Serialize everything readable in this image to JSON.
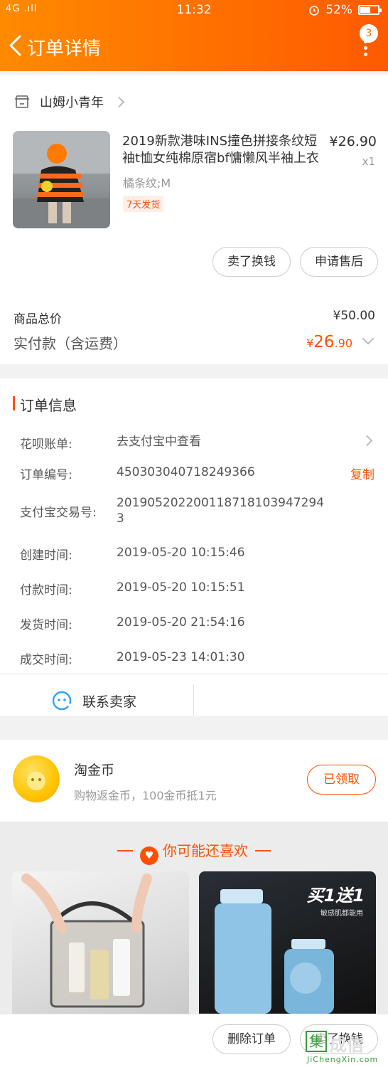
{
  "status_bar": {
    "carrier": "4G .ıll",
    "time": "11:32",
    "battery": "52%",
    "battery_level": 0.52
  },
  "nav": {
    "title": "订单详情",
    "badge": "3"
  },
  "shop": {
    "name": "山姆小青年"
  },
  "product": {
    "title": "2019新款港味INS撞色拼接条纹短袖t恤女纯棉原宿bf慵懒风半袖上衣",
    "price": "¥26.90",
    "qty": "x1",
    "spec": "橘条纹;M",
    "ship_tag": "7天发货",
    "actions": [
      "卖了换钱",
      "申请售后"
    ]
  },
  "totals": {
    "total_label": "商品总价",
    "total_value": "¥50.00",
    "paid_label": "实付款（含运费）",
    "paid_currency": "¥",
    "paid_int": "26",
    "paid_dec": ".90"
  },
  "order_info": {
    "title": "订单信息",
    "copy_label": "复制",
    "rows": [
      {
        "k": "花呗账单:",
        "v": "去支付宝中查看"
      },
      {
        "k": "订单编号:",
        "v": "450303040718249366"
      },
      {
        "k": "支付宝交易号:",
        "v": "2019052022001187181039472943"
      },
      {
        "k": "创建时间:",
        "v": "2019-05-20 10:15:46"
      },
      {
        "k": "付款时间:",
        "v": "2019-05-20 10:15:51"
      },
      {
        "k": "发货时间:",
        "v": "2019-05-20 21:54:16"
      },
      {
        "k": "成交时间:",
        "v": "2019-05-23 14:01:30"
      }
    ]
  },
  "contact": {
    "label": "联系卖家"
  },
  "coins": {
    "title": "淘金币",
    "subtitle": "购物返金币，100金币抵1元",
    "button": "已领取"
  },
  "recommend": {
    "title": "你可能还喜欢",
    "promo": "买1送1",
    "promo_sub": "敏感肌都能用"
  },
  "bottom": {
    "delete": "删除订单",
    "sell": "卖了换钱"
  },
  "watermark": {
    "site": "JiChengXin.com",
    "char": "集",
    "name": "成信"
  },
  "colors": {
    "accent": "#ff5000",
    "header_start": "#ff8a00",
    "header_end": "#ff5a00"
  }
}
